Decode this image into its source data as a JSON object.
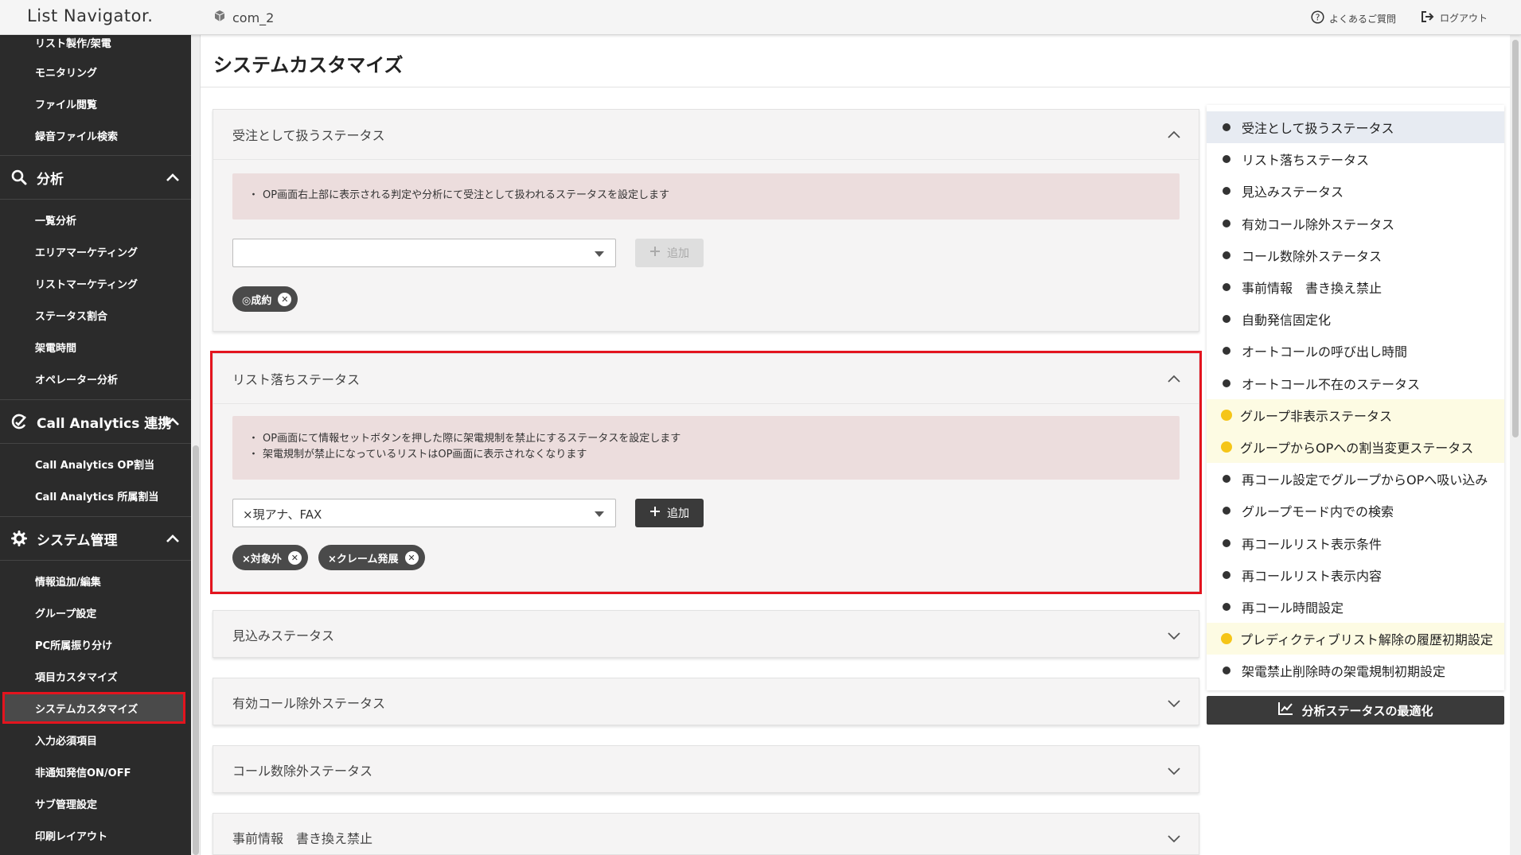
{
  "header": {
    "logo": "List Navigator.",
    "company": "com_2",
    "faq_label": "よくあるご質問",
    "logout_label": "ログアウト"
  },
  "sidebar": {
    "top_items": [
      {
        "label": "リスト製作/架電"
      },
      {
        "label": "モニタリング"
      },
      {
        "label": "ファイル閲覧"
      },
      {
        "label": "録音ファイル検索"
      }
    ],
    "sections": [
      {
        "title": "分析",
        "icon": "search-icon",
        "items": [
          {
            "label": "一覧分析"
          },
          {
            "label": "エリアマーケティング"
          },
          {
            "label": "リストマーケティング"
          },
          {
            "label": "ステータス割合"
          },
          {
            "label": "架電時間"
          },
          {
            "label": "オペレーター分析"
          }
        ]
      },
      {
        "title": "Call Analytics 連携",
        "icon": "call-analytics-icon",
        "items": [
          {
            "label": "Call Analytics OP割当"
          },
          {
            "label": "Call Analytics 所属割当"
          }
        ]
      },
      {
        "title": "システム管理",
        "icon": "gear-icon",
        "items": [
          {
            "label": "情報追加/編集"
          },
          {
            "label": "グループ設定"
          },
          {
            "label": "PC所属振り分け"
          },
          {
            "label": "項目カスタマイズ"
          },
          {
            "label": "システムカスタマイズ"
          },
          {
            "label": "入力必須項目"
          },
          {
            "label": "非通知発信ON/OFF"
          },
          {
            "label": "サブ管理設定"
          },
          {
            "label": "印刷レイアウト"
          }
        ]
      }
    ]
  },
  "page": {
    "title": "システムカスタマイズ"
  },
  "cards": {
    "order_status": {
      "title": "受注として扱うステータス",
      "notes": [
        "OP画面右上部に表示される判定や分析にて受注として扱われるステータスを設定します"
      ],
      "select_value": "",
      "add_label": "追加",
      "chips": [
        "◎成約"
      ]
    },
    "list_drop_status": {
      "title": "リスト落ちステータス",
      "notes": [
        "OP画面にて情報セットボタンを押した際に架電規制を禁止にするステータスを設定します",
        "架電規制が禁止になっているリストはOP画面に表示されなくなります"
      ],
      "select_value": "×現アナ、FAX",
      "add_label": "追加",
      "chips": [
        "×対象外",
        "×クレーム発展"
      ]
    },
    "collapsed": [
      {
        "title": "見込みステータス"
      },
      {
        "title": "有効コール除外ステータス"
      },
      {
        "title": "コール数除外ステータス"
      },
      {
        "title": "事前情報　書き換え禁止"
      }
    ]
  },
  "rnav": {
    "items": [
      {
        "label": "受注として扱うステータス",
        "state": "active"
      },
      {
        "label": "リスト落ちステータス",
        "state": "normal"
      },
      {
        "label": "見込みステータス",
        "state": "normal"
      },
      {
        "label": "有効コール除外ステータス",
        "state": "normal"
      },
      {
        "label": "コール数除外ステータス",
        "state": "normal"
      },
      {
        "label": "事前情報　書き換え禁止",
        "state": "normal"
      },
      {
        "label": "自動発信固定化",
        "state": "normal"
      },
      {
        "label": "オートコールの呼び出し時間",
        "state": "normal"
      },
      {
        "label": "オートコール不在のステータス",
        "state": "normal"
      },
      {
        "label": "グループ非表示ステータス",
        "state": "warn"
      },
      {
        "label": "グループからOPへの割当変更ステータス",
        "state": "warn"
      },
      {
        "label": "再コール設定でグループからOPへ吸い込み",
        "state": "normal"
      },
      {
        "label": "グループモード内での検索",
        "state": "normal"
      },
      {
        "label": "再コールリスト表示条件",
        "state": "normal"
      },
      {
        "label": "再コールリスト表示内容",
        "state": "normal"
      },
      {
        "label": "再コール時間設定",
        "state": "normal"
      },
      {
        "label": "プレディクティブリスト解除の履歴初期設定",
        "state": "warn"
      },
      {
        "label": "架電禁止削除時の架電規制初期設定",
        "state": "normal"
      }
    ],
    "optimize_label": "分析ステータスの最適化"
  },
  "colors": {
    "sidebar_bg": "#2b2b2b",
    "highlight_red": "#e3141e",
    "note_bg": "#ecdddd",
    "warn_yellow": "#f5c518",
    "active_row": "#e7ebf2"
  }
}
